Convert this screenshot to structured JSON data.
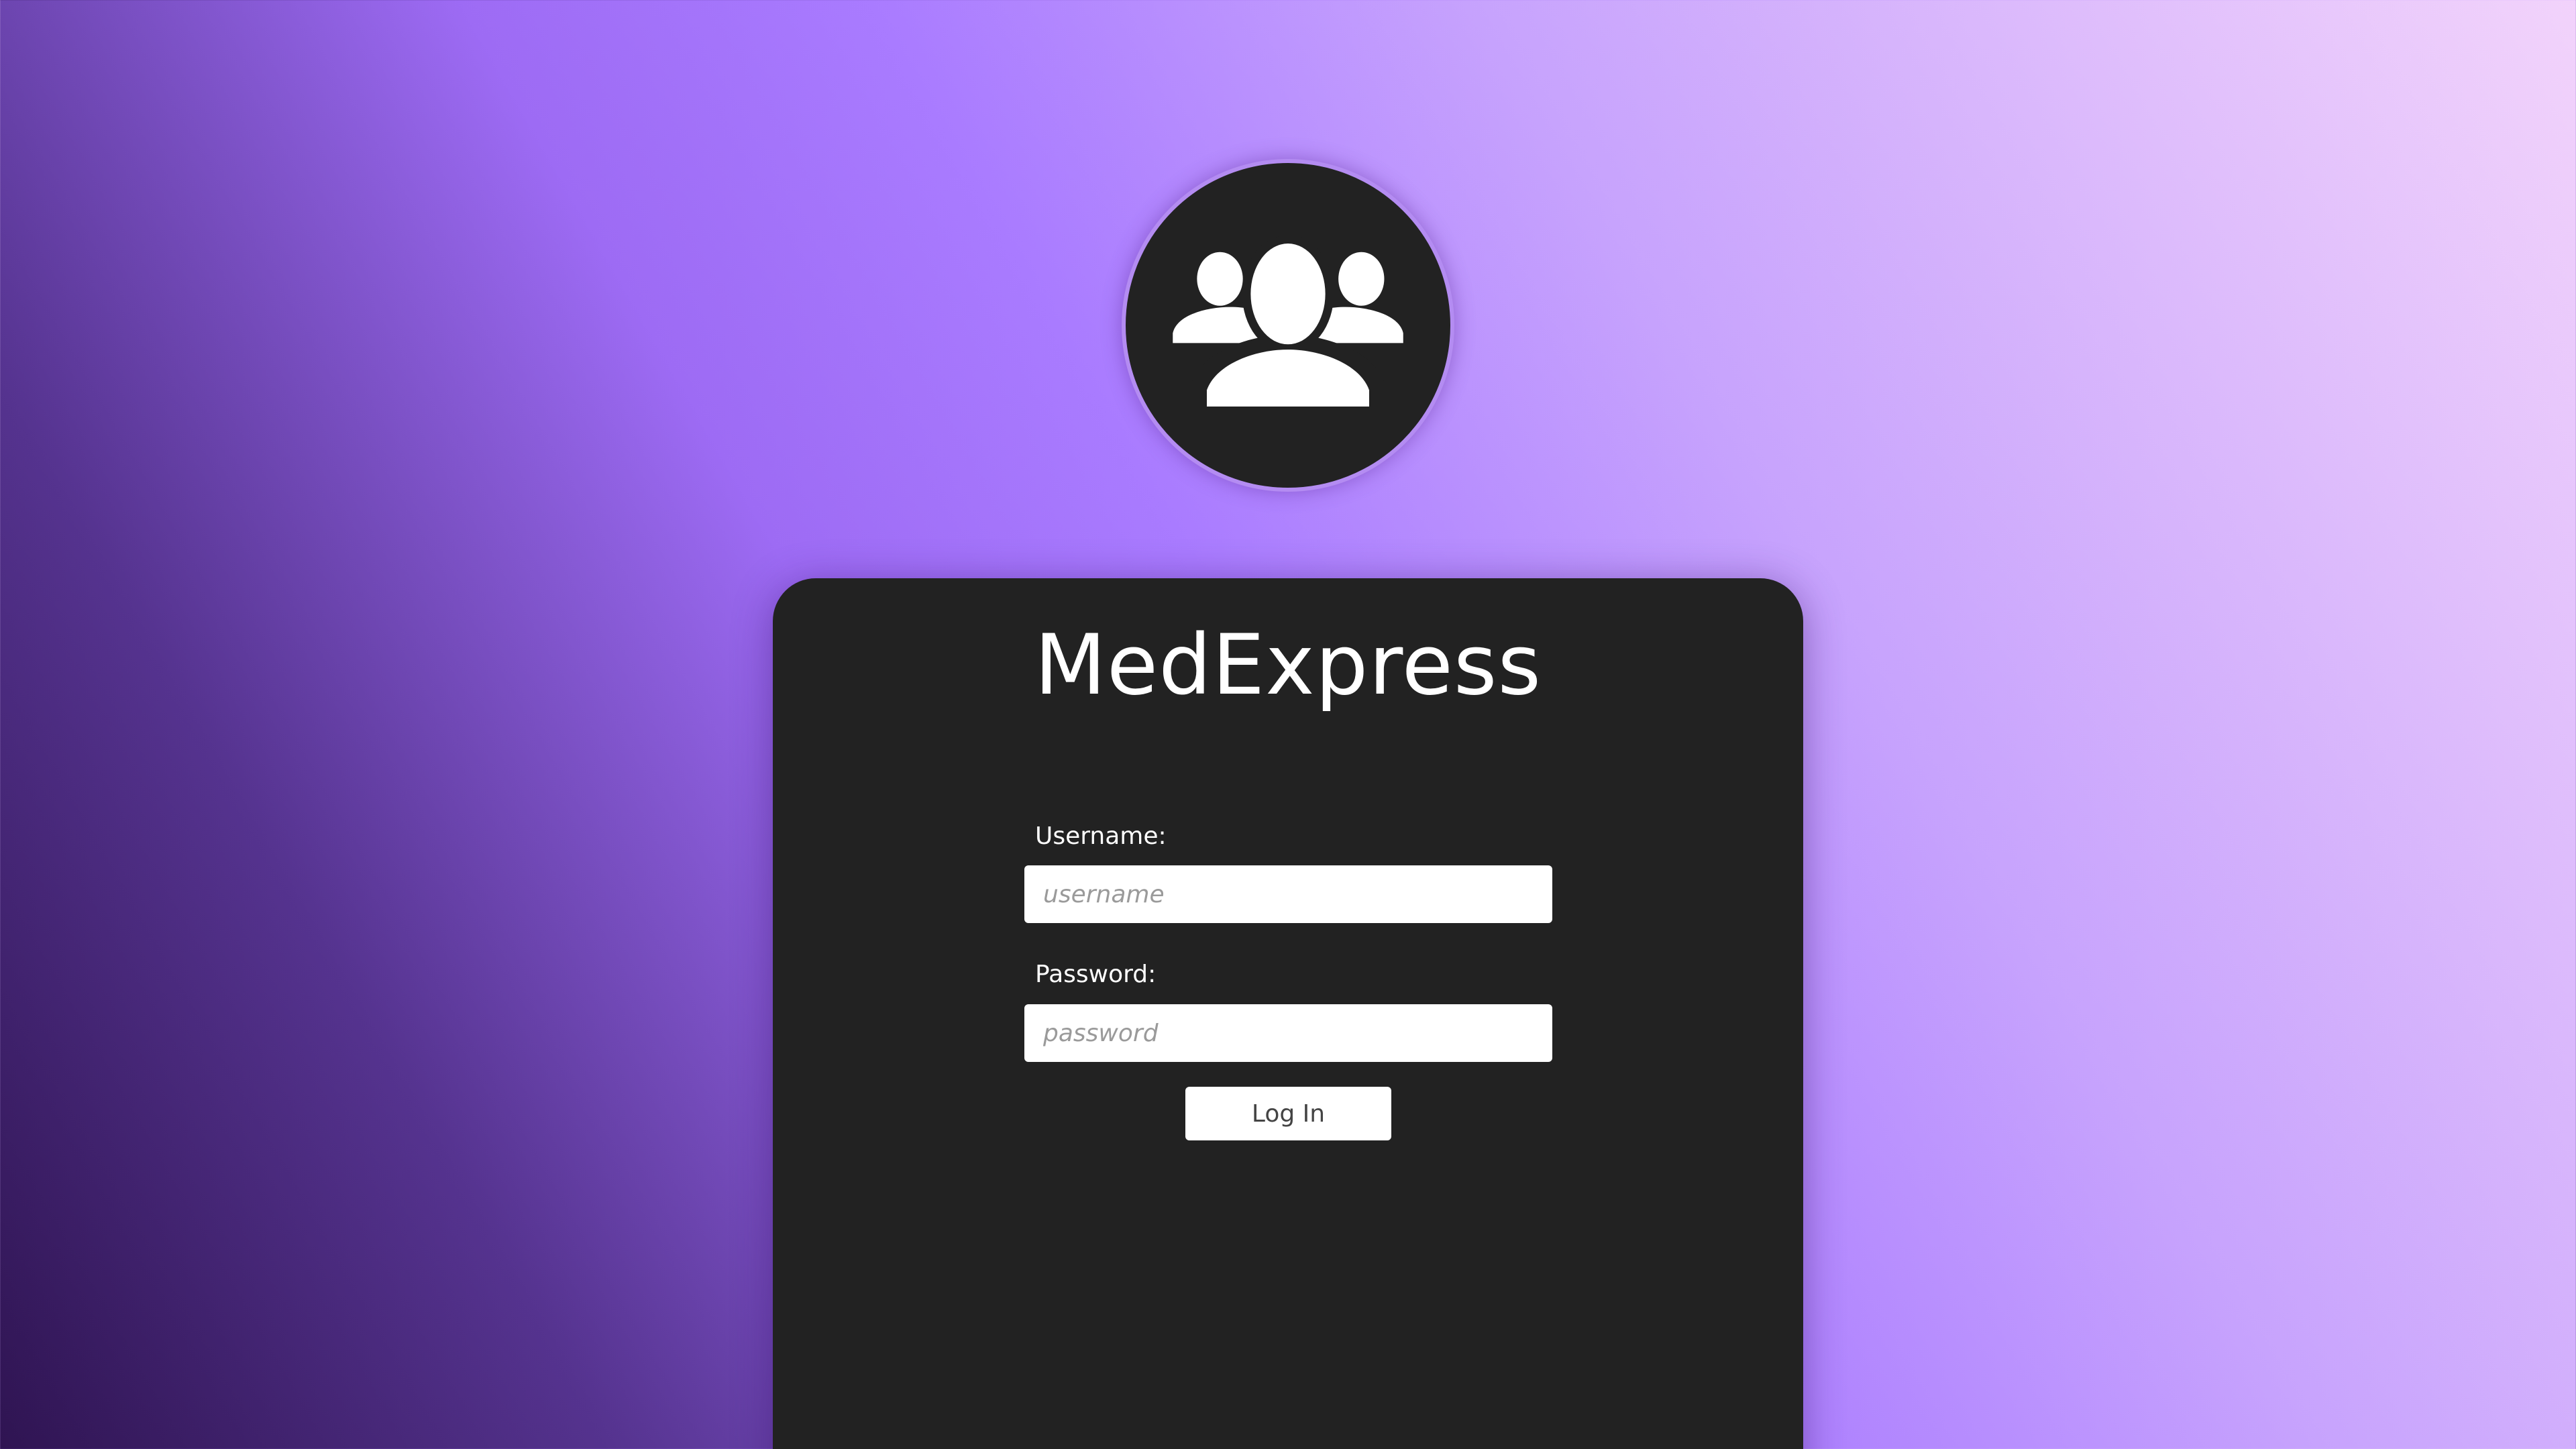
{
  "app": {
    "title": "MedExpress",
    "logo_icon": "users-group-icon"
  },
  "login_form": {
    "username_label": "Username:",
    "username_placeholder": "username",
    "username_value": "",
    "password_label": "Password:",
    "password_placeholder": "password",
    "password_value": "",
    "submit_label": "Log In"
  },
  "colors": {
    "card_background": "#222222",
    "avatar_ring": "#b48cf2",
    "gradient_dark": "#2f1452",
    "gradient_mid": "#a97bff",
    "gradient_light": "#f2d3fb",
    "text_primary": "#ffffff"
  }
}
